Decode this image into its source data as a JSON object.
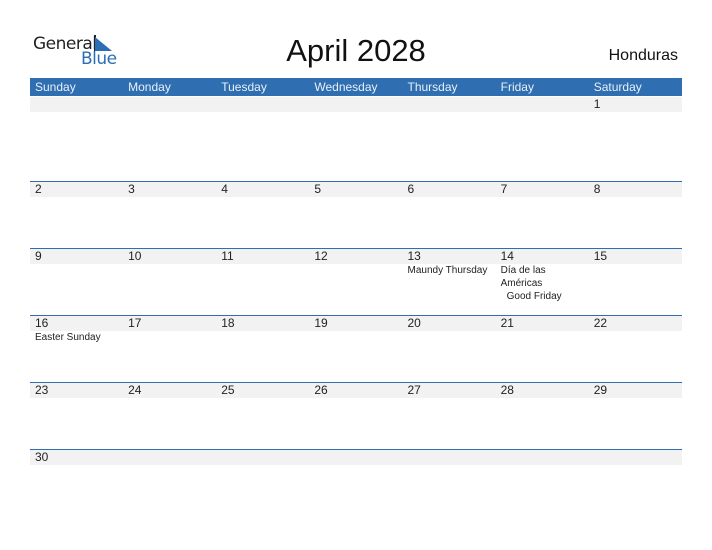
{
  "logo": {
    "general": "General",
    "blue": "Blue",
    "brand_color": "#2c6eb5"
  },
  "title": "April 2028",
  "country": "Honduras",
  "colors": {
    "header_bg": "#2f6eb0",
    "day_strip": "#f2f2f2"
  },
  "weekdays": [
    "Sunday",
    "Monday",
    "Tuesday",
    "Wednesday",
    "Thursday",
    "Friday",
    "Saturday"
  ],
  "weeks": [
    [
      {
        "day": ""
      },
      {
        "day": ""
      },
      {
        "day": ""
      },
      {
        "day": ""
      },
      {
        "day": ""
      },
      {
        "day": ""
      },
      {
        "day": "1"
      }
    ],
    [
      {
        "day": "2"
      },
      {
        "day": "3"
      },
      {
        "day": "4"
      },
      {
        "day": "5"
      },
      {
        "day": "6"
      },
      {
        "day": "7"
      },
      {
        "day": "8"
      }
    ],
    [
      {
        "day": "9"
      },
      {
        "day": "10"
      },
      {
        "day": "11"
      },
      {
        "day": "12"
      },
      {
        "day": "13",
        "events": [
          "Maundy Thursday"
        ]
      },
      {
        "day": "14",
        "events": [
          "Día de las Américas",
          "Good Friday"
        ]
      },
      {
        "day": "15"
      }
    ],
    [
      {
        "day": "16",
        "events": [
          "Easter Sunday"
        ]
      },
      {
        "day": "17"
      },
      {
        "day": "18"
      },
      {
        "day": "19"
      },
      {
        "day": "20"
      },
      {
        "day": "21"
      },
      {
        "day": "22"
      }
    ],
    [
      {
        "day": "23"
      },
      {
        "day": "24"
      },
      {
        "day": "25"
      },
      {
        "day": "26"
      },
      {
        "day": "27"
      },
      {
        "day": "28"
      },
      {
        "day": "29"
      }
    ],
    [
      {
        "day": "30"
      },
      {
        "day": ""
      },
      {
        "day": ""
      },
      {
        "day": ""
      },
      {
        "day": ""
      },
      {
        "day": ""
      },
      {
        "day": ""
      }
    ]
  ]
}
